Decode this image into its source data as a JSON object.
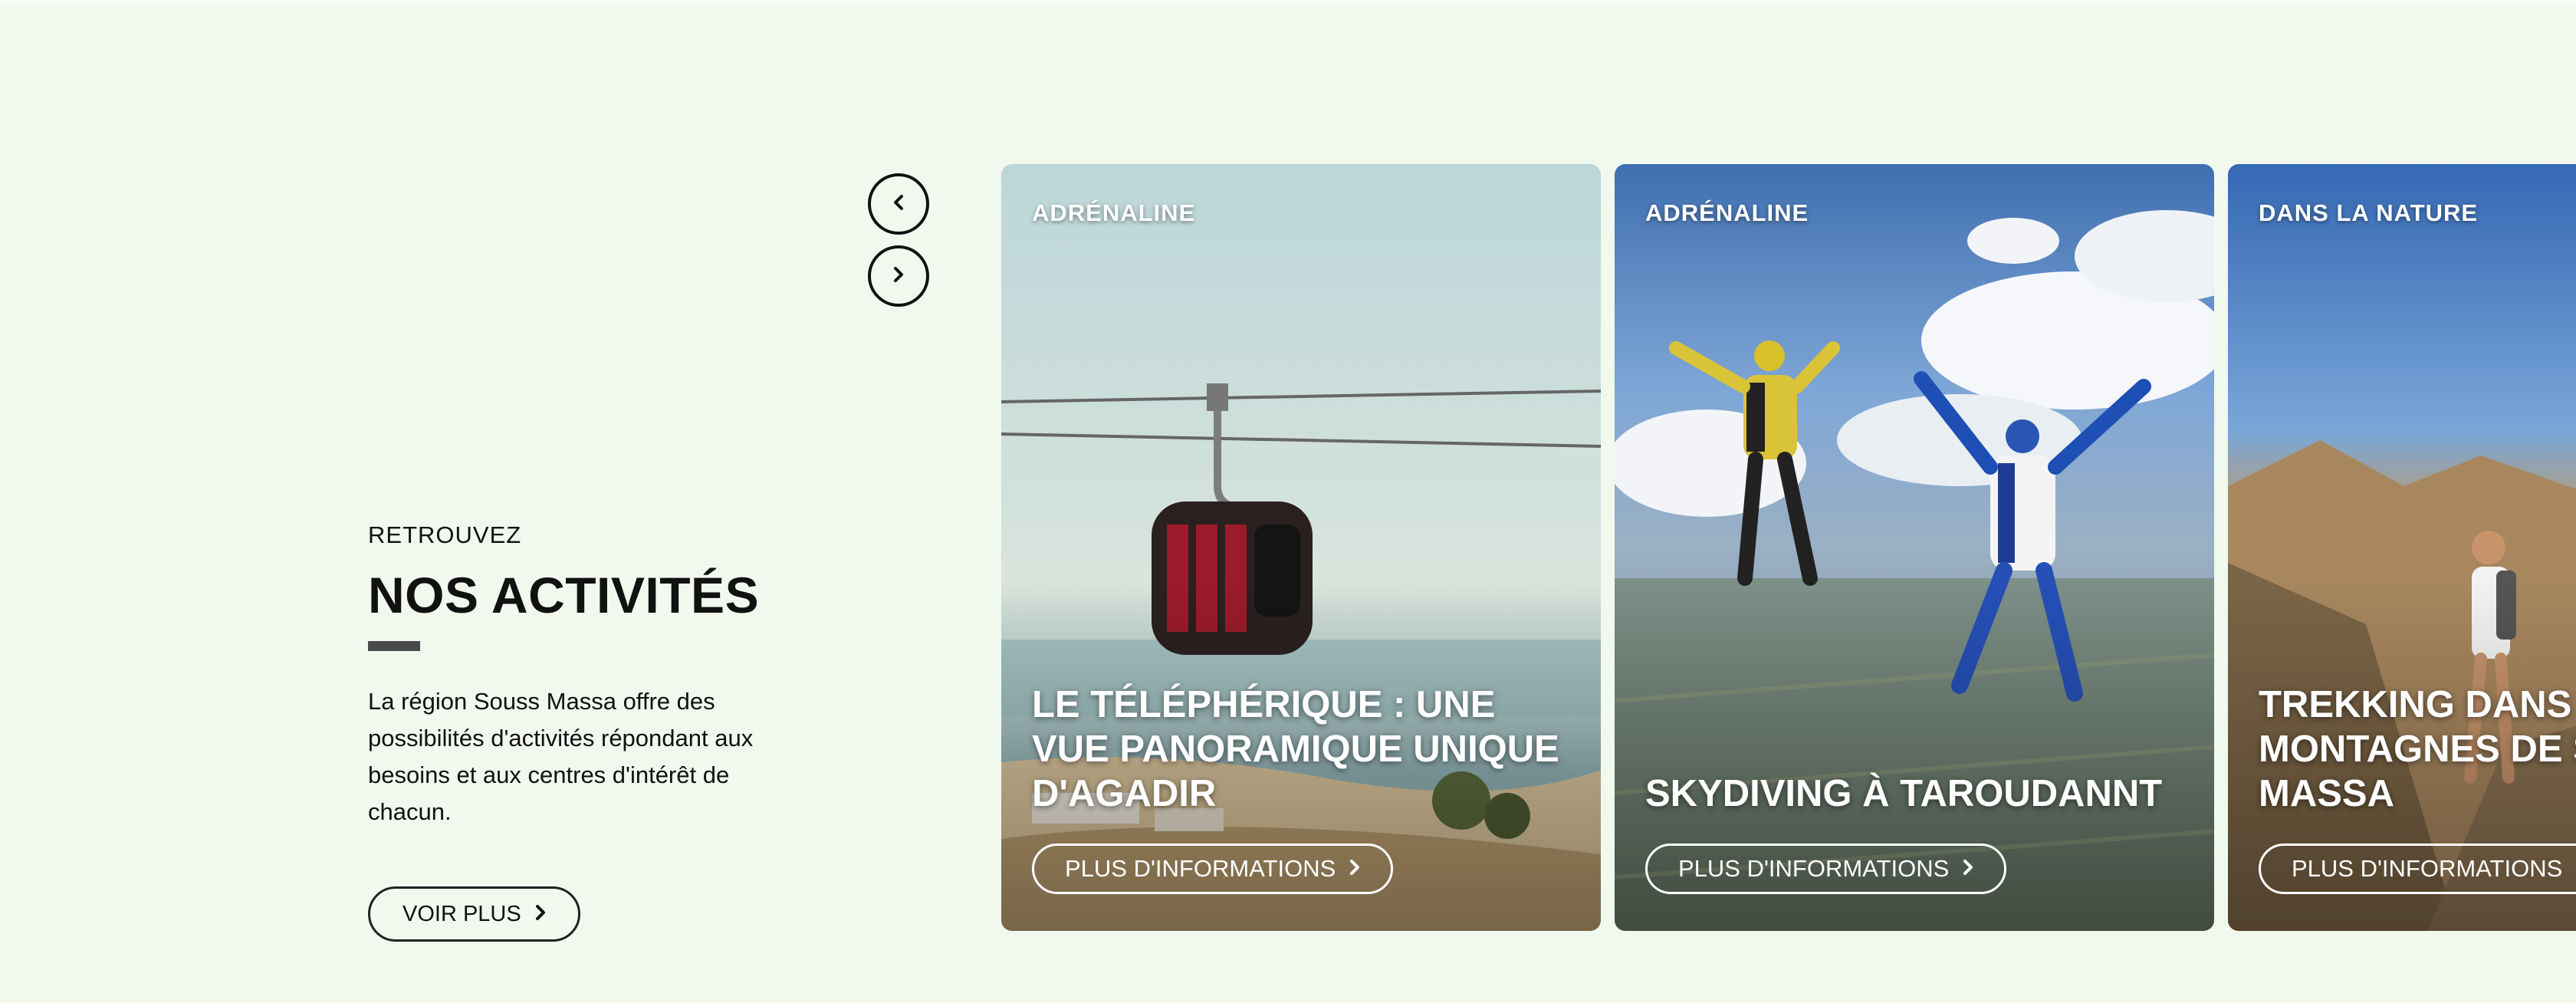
{
  "intro": {
    "eyebrow": "RETROUVEZ",
    "heading": "NOS ACTIVITÉS",
    "description": "La région Souss Massa offre des possibilités d'activités répondant aux besoins et aux centres d'intérêt de chacun.",
    "button_label": "VOIR PLUS"
  },
  "carousel": {
    "cards": [
      {
        "tag": "ADRÉNALINE",
        "title": "LE TÉLÉPHÉRIQUE : UNE VUE PANORAMIQUE UNIQUE D'AGADIR",
        "button_label": "PLUS D'INFORMATIONS"
      },
      {
        "tag": "ADRÉNALINE",
        "title": "SKYDIVING À TAROUDANNT",
        "button_label": "PLUS D'INFORMATIONS"
      },
      {
        "tag": "DANS LA NATURE",
        "title": "TREKKING DANS LES MONTAGNES DE SOUSS MASSA",
        "button_label": "PLUS D'INFORMATIONS"
      }
    ]
  },
  "icons": {
    "prev": "chevron-left-icon",
    "next": "chevron-right-icon"
  },
  "colors": {
    "background": "#f1f8ee",
    "text": "#111111",
    "accent_bar": "#4a4a4a"
  }
}
